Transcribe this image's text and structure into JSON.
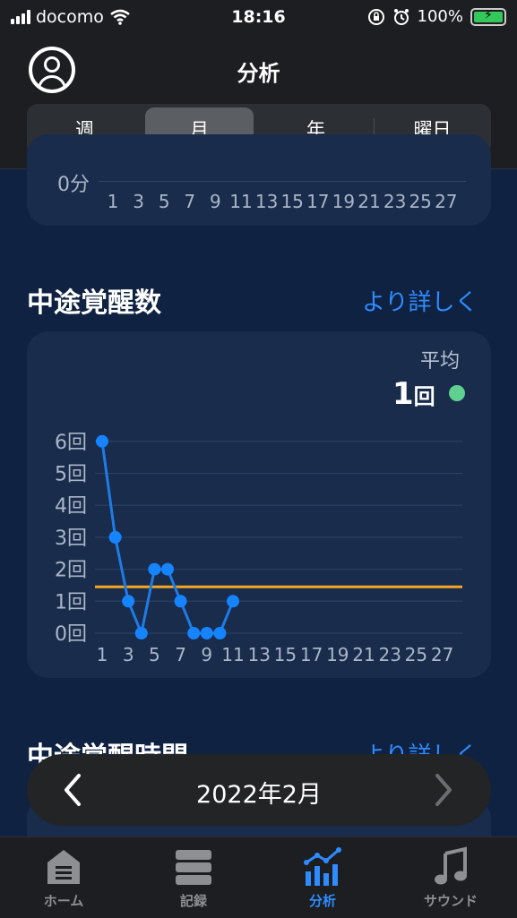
{
  "status_bar": {
    "carrier": "docomo",
    "time": "18:16",
    "battery": "100%"
  },
  "header": {
    "title": "分析",
    "segments": [
      "週",
      "月",
      "年",
      "曜日"
    ],
    "selected_segment": "月"
  },
  "prev_chart_fragment": {
    "y_label": "0分",
    "x_ticks": [
      "1",
      "3",
      "5",
      "7",
      "9",
      "11",
      "13",
      "15",
      "17",
      "19",
      "21",
      "23",
      "25",
      "27"
    ]
  },
  "awakenings": {
    "title": "中途覚醒数",
    "more_link": "より詳しく",
    "average_label": "平均",
    "average_value": "1",
    "average_unit": "回",
    "chart_data": {
      "type": "line",
      "x": [
        1,
        2,
        3,
        4,
        5,
        6,
        7,
        8,
        9,
        10,
        11
      ],
      "values": [
        6,
        3,
        1,
        0,
        2,
        2,
        1,
        0,
        0,
        0,
        1
      ],
      "average_line": 1.45,
      "y_ticks": [
        "0回",
        "1回",
        "2回",
        "3回",
        "4回",
        "5回",
        "6回"
      ],
      "x_ticks": [
        "1",
        "3",
        "5",
        "7",
        "9",
        "11",
        "13",
        "15",
        "17",
        "19",
        "21",
        "23",
        "25",
        "27"
      ],
      "ylim": [
        0,
        6
      ],
      "xlim": [
        1,
        28
      ],
      "colors": {
        "line": "#1f7be6",
        "point": "#1684ff",
        "average": "#f5a623"
      }
    }
  },
  "awake_time": {
    "title": "中途覚醒時間",
    "more_link": "より詳しく"
  },
  "date_nav": {
    "label": "2022年2月",
    "prev_icon": "chevron-left-icon",
    "next_icon": "chevron-right-icon"
  },
  "tabbar": {
    "items": [
      {
        "label": "ホーム",
        "icon": "home-icon"
      },
      {
        "label": "記録",
        "icon": "records-icon"
      },
      {
        "label": "分析",
        "icon": "analytics-icon"
      },
      {
        "label": "サウンド",
        "icon": "music-note-icon"
      }
    ],
    "active": "分析"
  }
}
